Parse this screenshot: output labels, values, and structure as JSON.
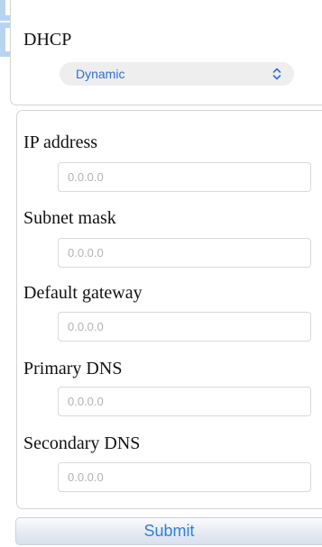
{
  "dhcp": {
    "label": "DHCP",
    "selected": "Dynamic"
  },
  "static": {
    "fields": [
      {
        "label": "IP address",
        "value": "",
        "placeholder": "0.0.0.0"
      },
      {
        "label": "Subnet mask",
        "value": "",
        "placeholder": "0.0.0.0"
      },
      {
        "label": "Default gateway",
        "value": "",
        "placeholder": "0.0.0.0"
      },
      {
        "label": "Primary DNS",
        "value": "",
        "placeholder": "0.0.0.0"
      },
      {
        "label": "Secondary DNS",
        "value": "",
        "placeholder": "0.0.0.0"
      }
    ]
  },
  "submit": {
    "label": "Submit"
  },
  "colors": {
    "accent": "#2f7ee0",
    "select_text": "#2f6fd6",
    "logo": "#7fb0e8"
  },
  "icons": {
    "select": "chevron-up-down-icon",
    "brand": "logo-icon"
  }
}
